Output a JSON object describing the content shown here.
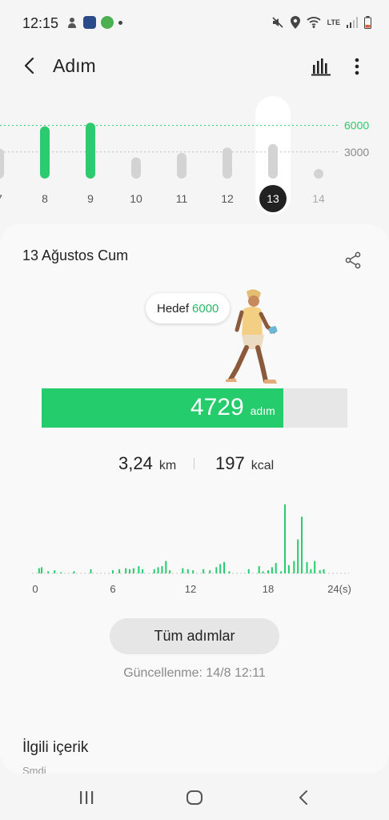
{
  "status_bar": {
    "time": "12:15",
    "network": "LTE"
  },
  "app_bar": {
    "title": "Adım"
  },
  "week_chart": {
    "days": [
      "7",
      "8",
      "9",
      "10",
      "11",
      "12",
      "13",
      "14"
    ],
    "values": [
      3400,
      5900,
      6300,
      2400,
      2900,
      3500,
      3900,
      0
    ],
    "goal_reached": [
      false,
      true,
      true,
      false,
      false,
      false,
      false,
      false
    ],
    "selected": "13",
    "goal_label": "6000",
    "mid_label": "3000",
    "ymax": 7500,
    "colors": {
      "goal": "#2ccb6f",
      "normal": "#d3d3d3",
      "selected": "#222222"
    }
  },
  "card": {
    "date": "13 Ağustos Cum",
    "goal_label": "Hedef",
    "goal_value": "6000",
    "steps": "4729",
    "steps_unit": "adım",
    "goal_progress": 0.79,
    "distance": "3,24",
    "distance_unit": "km",
    "energy": "197",
    "energy_unit": "kcal",
    "button": "Tüm adımlar",
    "updated": "Güncellenme: 14/8 12:11",
    "accent": "#25cc6c"
  },
  "chart_data": {
    "type": "bar",
    "title": "",
    "xlabel": "",
    "ylabel": "",
    "x_ticks": [
      "0",
      "6",
      "12",
      "18",
      "24(s)"
    ],
    "x": [
      0.3,
      0.5,
      1.0,
      1.5,
      2.0,
      3.0,
      4.3,
      6.0,
      6.5,
      7.0,
      7.3,
      7.6,
      8.0,
      8.3,
      9.2,
      9.5,
      9.8,
      10.1,
      10.4,
      11.4,
      11.8,
      12.2,
      13.0,
      13.5,
      14.0,
      14.3,
      14.6,
      15.0,
      16.5,
      17.3,
      17.6,
      18.0,
      18.3,
      18.6,
      19.0,
      19.3,
      19.6,
      20.0,
      20.3,
      20.6,
      21.0,
      21.3,
      21.6,
      22.0,
      22.3
    ],
    "values": [
      5,
      6,
      2,
      3,
      1,
      2,
      4,
      3,
      4,
      5,
      4,
      5,
      7,
      4,
      4,
      6,
      7,
      12,
      3,
      5,
      4,
      3,
      4,
      3,
      6,
      9,
      11,
      2,
      4,
      7,
      2,
      3,
      6,
      10,
      2,
      67,
      8,
      12,
      33,
      55,
      11,
      4,
      12,
      3,
      4
    ],
    "xlim": [
      0,
      24
    ],
    "color": "#25cc6c"
  },
  "related": {
    "title": "İlgili içerik",
    "subtitle": "Şmdi"
  }
}
